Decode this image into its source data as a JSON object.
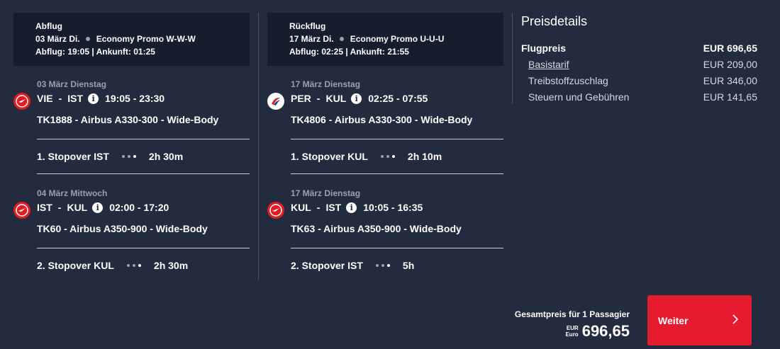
{
  "outbound": {
    "header": {
      "title": "Abflug",
      "date": "03 März Di.",
      "fare": "Economy Promo W-W-W",
      "times": "Abflug: 19:05 | Ankunft: 01:25"
    },
    "segments": [
      {
        "date": "03 März Dienstag",
        "origin": "VIE",
        "destination": "IST",
        "times": "19:05 - 23:30",
        "flight": "TK1888 - Airbus A330-300 - Wide-Body",
        "stopover": "1. Stopover IST",
        "stop_duration": "2h 30m",
        "airline_icon": "turkish-airlines-icon"
      },
      {
        "date": "04 März Mittwoch",
        "origin": "IST",
        "destination": "KUL",
        "times": "02:00 - 17:20",
        "flight": "TK60 - Airbus A350-900 - Wide-Body",
        "stopover": "2. Stopover KUL",
        "stop_duration": "2h 30m",
        "airline_icon": "turkish-airlines-icon"
      }
    ]
  },
  "return": {
    "header": {
      "title": "Rückflug",
      "date": "17 März Di.",
      "fare": "Economy Promo U-U-U",
      "times": "Abflug: 02:25 | Ankunft: 21:55"
    },
    "segments": [
      {
        "date": "17 März Dienstag",
        "origin": "PER",
        "destination": "KUL",
        "times": "02:25 - 07:55",
        "flight": "TK4806 - Airbus A330-300 - Wide-Body",
        "stopover": "1. Stopover KUL",
        "stop_duration": "2h 10m",
        "airline_icon": "malaysia-airlines-icon"
      },
      {
        "date": "17 März Dienstag",
        "origin": "KUL",
        "destination": "IST",
        "times": "10:05 - 16:35",
        "flight": "TK63 - Airbus A350-900 - Wide-Body",
        "stopover": "2. Stopover IST",
        "stop_duration": "5h",
        "airline_icon": "turkish-airlines-icon"
      }
    ]
  },
  "route_separator": "-",
  "price_details": {
    "title": "Preisdetails",
    "main_label": "Flugpreis",
    "main_value": "EUR 696,65",
    "items": [
      {
        "label": "Basistarif",
        "value": "EUR 209,00"
      },
      {
        "label": "Treibstoffzuschlag",
        "value": "EUR 346,00"
      },
      {
        "label": "Steuern und Gebühren",
        "value": "EUR 141,65"
      }
    ]
  },
  "total": {
    "label": "Gesamtpreis für 1 Passagier",
    "currency_code": "EUR",
    "currency_name": "Euro",
    "amount": "696,65"
  },
  "continue_button": {
    "label": "Weiter"
  },
  "colors": {
    "background": "#232b3e",
    "header_bg": "#161d2d",
    "accent": "#e61b2f"
  }
}
